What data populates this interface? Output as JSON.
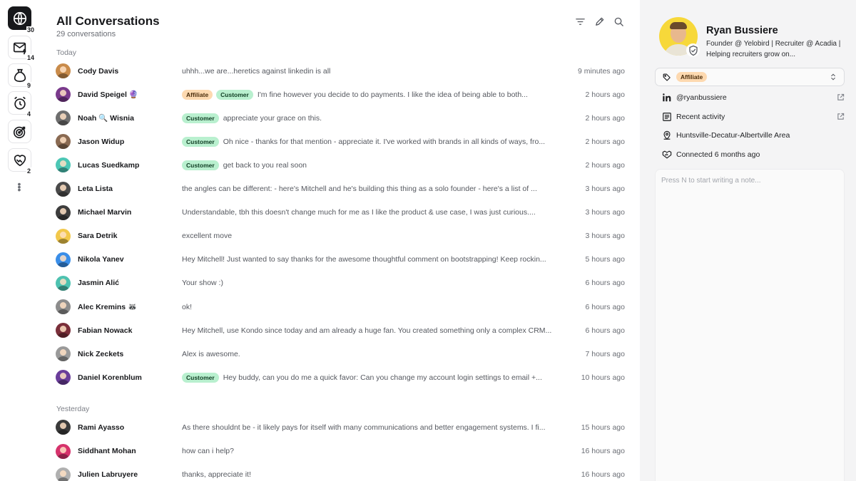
{
  "rail": {
    "items": [
      {
        "icon": "globe-icon",
        "count": "30",
        "active": true
      },
      {
        "icon": "mail-bolt-icon",
        "count": "14",
        "active": false
      },
      {
        "icon": "money-bag-icon",
        "count": "9",
        "active": false
      },
      {
        "icon": "alarm-clock-icon",
        "count": "4",
        "active": false
      },
      {
        "icon": "target-icon",
        "count": "",
        "active": false
      },
      {
        "icon": "heart-handshake-icon",
        "count": "2",
        "active": false
      }
    ],
    "more": "⋮"
  },
  "header": {
    "title": "All Conversations",
    "subtitle": "29 conversations",
    "tools": [
      "filter-icon",
      "pencil-icon",
      "search-icon"
    ]
  },
  "groups": [
    {
      "label": "Today",
      "rows": [
        {
          "name": "Cody Davis",
          "tags": [],
          "message": "uhhh...we are...heretics against linkedin is all",
          "time": "9 minutes ago",
          "color": "#c98b4a"
        },
        {
          "name": "David Speigel 🔮",
          "tags": [
            "Affiliate",
            "Customer"
          ],
          "message": "I'm fine however you decide to do payments. I like the idea of being able to both...",
          "time": "2 hours ago",
          "color": "#7a3a8c"
        },
        {
          "name": "Noah 🔍 Wisnia",
          "tags": [
            "Customer"
          ],
          "message": "appreciate your grace on this.",
          "time": "2 hours ago",
          "color": "#6e6e6e"
        },
        {
          "name": "Jason Widup",
          "tags": [
            "Customer"
          ],
          "message": "Oh nice - thanks for that mention - appreciate it. I've worked with brands in all kinds of ways, fro...",
          "time": "2 hours ago",
          "color": "#8a6a52"
        },
        {
          "name": "Lucas Suedkamp",
          "tags": [
            "Customer"
          ],
          "message": "get back to you real soon",
          "time": "2 hours ago",
          "color": "#4cc7b5"
        },
        {
          "name": "Leta Lista",
          "tags": [],
          "message": "the angles can be different:  - here's Mitchell and he's building this thing as a solo founder  - here's a list of ...",
          "time": "3 hours ago",
          "color": "#4a4a4a"
        },
        {
          "name": "Michael Marvin",
          "tags": [],
          "message": "Understandable, tbh this doesn't change much for me as I like the product & use case, I was just curious....",
          "time": "3 hours ago",
          "color": "#3d3d3d"
        },
        {
          "name": "Sara Detrik",
          "tags": [],
          "message": "excellent move",
          "time": "3 hours ago",
          "color": "#f2c84b"
        },
        {
          "name": "Nikola Yanev",
          "tags": [],
          "message": "Hey Mitchell! Just wanted to say thanks for the awesome thoughtful comment on bootstrapping! Keep rockin...",
          "time": "5 hours ago",
          "color": "#3a8ee8"
        },
        {
          "name": "Jasmin Alić",
          "tags": [],
          "message": "Your show :)",
          "time": "6 hours ago",
          "color": "#4ec2b0"
        },
        {
          "name": "Alec Kremins 🦝",
          "tags": [],
          "message": "ok!",
          "time": "6 hours ago",
          "color": "#8c8c8c"
        },
        {
          "name": "Fabian Nowack",
          "tags": [],
          "message": "Hey Mitchell, use Kondo since today and am already a huge fan.  You created something only a complex CRM...",
          "time": "6 hours ago",
          "color": "#7a2f3a"
        },
        {
          "name": "Nick Zeckets",
          "tags": [],
          "message": "Alex is awesome.",
          "time": "7 hours ago",
          "color": "#9a9a9a"
        },
        {
          "name": "Daniel Korenblum",
          "tags": [
            "Customer"
          ],
          "message": "Hey buddy, can you do me a quick favor: Can you change my account login settings to email +...",
          "time": "10 hours ago",
          "color": "#6a3d9a"
        }
      ]
    },
    {
      "label": "Yesterday",
      "rows": [
        {
          "name": "Rami Ayasso",
          "tags": [],
          "message": "As there shouldnt be - it likely pays for itself with many communications and better engagement systems. I fi...",
          "time": "15 hours ago",
          "color": "#3a3a3a"
        },
        {
          "name": "Siddhant Mohan",
          "tags": [],
          "message": "how can i help?",
          "time": "16 hours ago",
          "color": "#d6336c"
        },
        {
          "name": "Julien Labruyere",
          "tags": [],
          "message": "thanks, appreciate it!",
          "time": "16 hours ago",
          "color": "#b0b0b0"
        }
      ]
    }
  ],
  "profile": {
    "name": "Ryan Bussiere",
    "bio": "Founder @ Yelobird | Recruiter @ Acadia | Helping recruiters grow on...",
    "label_tag": "Affiliate",
    "info": [
      {
        "icon": "linkedin-icon",
        "text": "@ryanbussiere",
        "external": true
      },
      {
        "icon": "activity-icon",
        "text": "Recent activity",
        "external": true
      },
      {
        "icon": "location-icon",
        "text": "Huntsville-Decatur-Albertville Area",
        "external": false
      },
      {
        "icon": "handshake-icon",
        "text": "Connected 6 months ago",
        "external": false
      }
    ],
    "note_placeholder": "Press N to start writing a note..."
  },
  "colors": {
    "affiliate_tag": "#fdd9b0",
    "customer_tag": "#b9f0cf",
    "panel_bg": "#f4f4f5",
    "active_rail": "#17181b",
    "profile_avatar_bg": "#f7d83a"
  }
}
